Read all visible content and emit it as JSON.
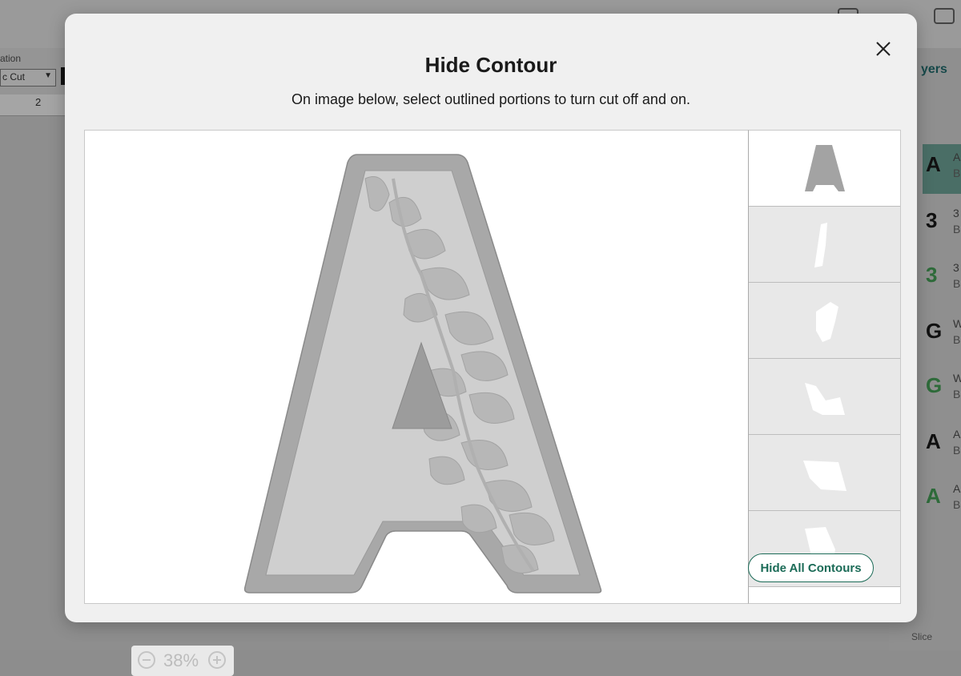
{
  "dialog": {
    "title": "Hide Contour",
    "subtitle": "On image below, select outlined portions to turn cut off and on.",
    "zoom_value": "38%",
    "hide_all_label": "Hide All Contours"
  },
  "background": {
    "toolbar_label": "ation",
    "operation_select": "c Cut",
    "ruler_tick": "2",
    "layers_title": "yers",
    "slice_label": "Slice",
    "layers": [
      {
        "glyph": "A",
        "title": "A",
        "sub": "B"
      },
      {
        "glyph": "3",
        "title": "3",
        "sub": "B"
      },
      {
        "glyph": "3",
        "title": "3",
        "sub": "B"
      },
      {
        "glyph": "G",
        "title": "W",
        "sub": "B"
      },
      {
        "glyph": "G",
        "title": "W",
        "sub": "B"
      },
      {
        "glyph": "A",
        "title": "A",
        "sub": "B"
      },
      {
        "glyph": "A",
        "title": "A",
        "sub": "B"
      }
    ]
  },
  "colors": {
    "accent": "#1b6b57",
    "overlay": "#8b8b8b",
    "modal_bg": "#f0f0f0"
  }
}
